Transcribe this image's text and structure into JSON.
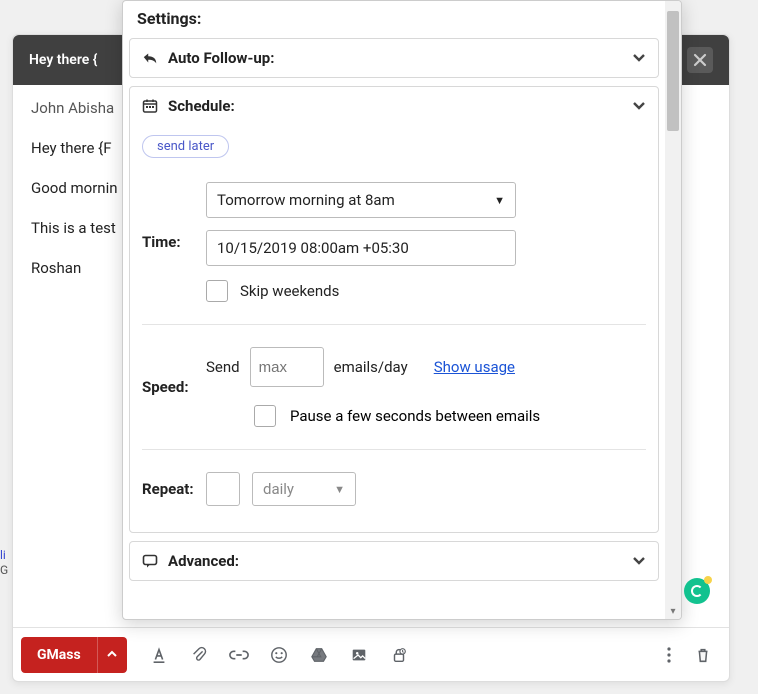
{
  "compose": {
    "subject_header": "Hey there {",
    "recipient": "John Abisha",
    "subject_line": "Hey there {F",
    "greeting": "Good mornin",
    "body_line": "This is a test",
    "signature": "Roshan"
  },
  "toolbar": {
    "send_label": "GMass"
  },
  "settings": {
    "title": "Settings:",
    "sections": {
      "auto_followup": {
        "label": "Auto Follow-up:"
      },
      "schedule": {
        "label": "Schedule:",
        "pill": "send later",
        "time_label": "Time:",
        "time_select": "Tomorrow morning at 8am",
        "time_text": "10/15/2019 08:00am +05:30",
        "skip_weekends": "Skip weekends",
        "speed_label": "Speed:",
        "speed_prefix": "Send",
        "speed_placeholder": "max",
        "speed_suffix": "emails/day",
        "show_usage": "Show usage",
        "pause_label": "Pause a few seconds between emails",
        "repeat_label": "Repeat:",
        "repeat_unit": "daily"
      },
      "advanced": {
        "label": "Advanced:"
      }
    }
  }
}
